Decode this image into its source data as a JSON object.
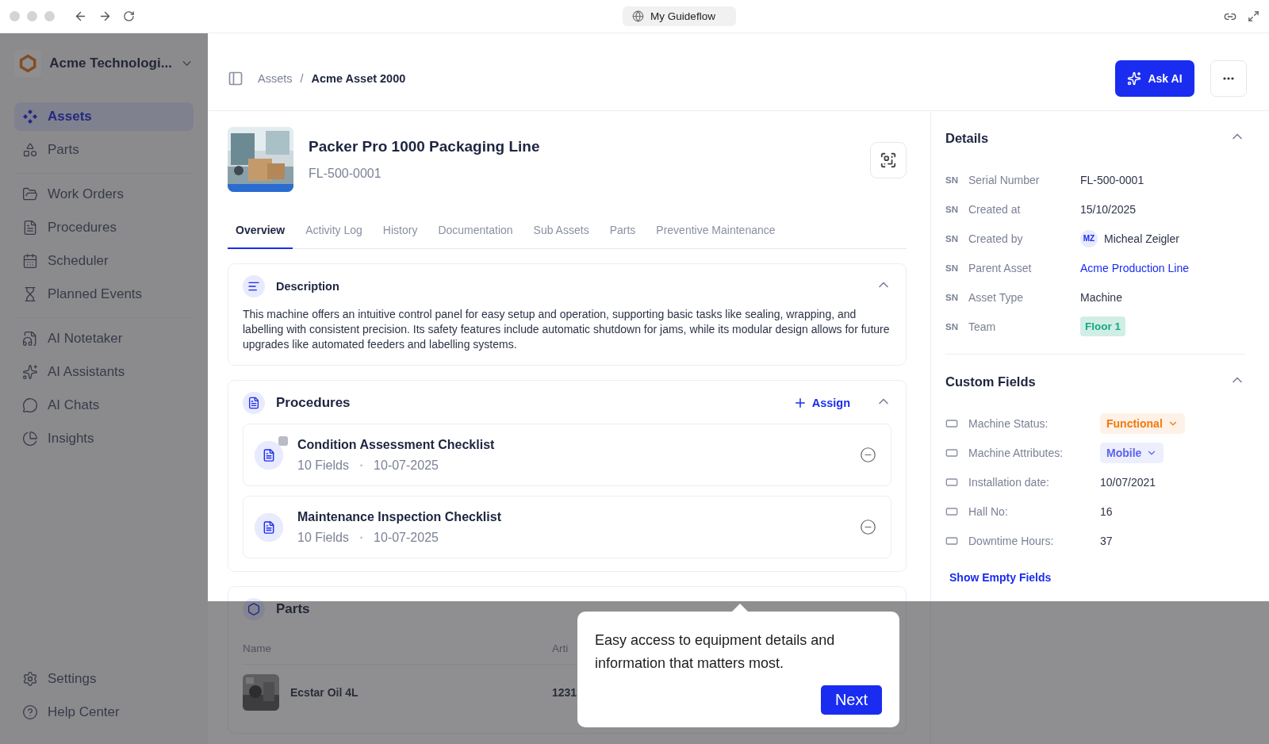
{
  "browser": {
    "address": "My Guideflow"
  },
  "sidebar": {
    "workspace": "Acme Technologi...",
    "groups": [
      [
        {
          "label": "Assets",
          "selected": true
        },
        {
          "label": "Parts",
          "selected": false
        }
      ],
      [
        {
          "label": "Work Orders",
          "selected": false
        },
        {
          "label": "Procedures",
          "selected": false
        },
        {
          "label": "Scheduler",
          "selected": false
        },
        {
          "label": "Planned Events",
          "selected": false
        }
      ],
      [
        {
          "label": "AI Notetaker",
          "selected": false
        },
        {
          "label": "AI Assistants",
          "selected": false
        },
        {
          "label": "AI Chats",
          "selected": false
        },
        {
          "label": "Insights",
          "selected": false
        }
      ]
    ],
    "footer": [
      {
        "label": "Settings",
        "selected": false
      },
      {
        "label": "Help Center",
        "selected": false
      }
    ]
  },
  "breadcrumb": [
    "Assets",
    "/",
    "Acme Asset 2000"
  ],
  "ask_ai": "Ask AI",
  "asset": {
    "title": "Packer Pro 1000 Packaging Line",
    "id": "FL-500-0001"
  },
  "tabs": [
    {
      "label": "Overview",
      "selected": true
    },
    {
      "label": "Activity Log",
      "selected": false
    },
    {
      "label": "History",
      "selected": false
    },
    {
      "label": "Documentation",
      "selected": false
    },
    {
      "label": "Sub Assets",
      "selected": false
    },
    {
      "label": "Parts",
      "selected": false
    },
    {
      "label": "Preventive Maintenance",
      "selected": false
    }
  ],
  "description": {
    "title": "Description",
    "expanded": true,
    "text": "This machine offers an intuitive control panel for easy setup and operation, supporting basic tasks like sealing, wrapping, and labelling with consistent precision. Its safety features include automatic shutdown for jams, while its modular design allows for future upgrades like automated feeders and labelling systems."
  },
  "procedures": {
    "title": "Procedures",
    "assign": "Assign",
    "expanded": true,
    "items": [
      {
        "name": "Condition Assessment Checklist",
        "fields": "10 Fields",
        "separator": "•",
        "date": "10-07-2025",
        "badge": true
      },
      {
        "name": "Maintenance Inspection Checklist",
        "fields": "10 Fields",
        "separator": "•",
        "date": "10-07-2025",
        "badge": false
      }
    ]
  },
  "parts": {
    "title": "Parts",
    "columns": [
      "Name",
      "Arti"
    ],
    "rows": [
      [
        "Ecstar Oil 4L",
        "1231"
      ]
    ]
  },
  "details": {
    "title": "Details",
    "expanded": true,
    "rows": [
      {
        "prefix": "SN",
        "label": "Serial Number",
        "kind": "text",
        "value": "FL-500-0001"
      },
      {
        "prefix": "SN",
        "label": "Created at",
        "kind": "text",
        "value": "15/10/2025"
      },
      {
        "prefix": "SN",
        "label": "Created by",
        "kind": "user",
        "initials": "MZ",
        "value": "Micheal Zeigler"
      },
      {
        "prefix": "SN",
        "label": "Parent Asset",
        "kind": "link",
        "value": "Acme Production Line"
      },
      {
        "prefix": "SN",
        "label": "Asset Type",
        "kind": "text",
        "value": "Machine"
      },
      {
        "prefix": "SN",
        "label": "Team",
        "kind": "tag",
        "value": "Floor 1",
        "color": "#14a884"
      }
    ]
  },
  "custom_fields": {
    "title": "Custom Fields",
    "expanded": true,
    "rows": [
      {
        "label": "Machine Status:",
        "kind": "select",
        "value": "Functional",
        "color": "#f2790f"
      },
      {
        "label": "Machine Attributes:",
        "kind": "select",
        "value": "Mobile",
        "color": "#5a63f0"
      },
      {
        "label": "Installation date:",
        "kind": "text",
        "value": "10/07/2021"
      },
      {
        "label": "Hall No:",
        "kind": "text",
        "value": "16"
      },
      {
        "label": "Downtime Hours:",
        "kind": "text",
        "value": "37"
      }
    ],
    "show_empty": "Show Empty Fields"
  },
  "tooltip": {
    "text": "Easy access to equipment details and information that matters most.",
    "button": "Next"
  }
}
